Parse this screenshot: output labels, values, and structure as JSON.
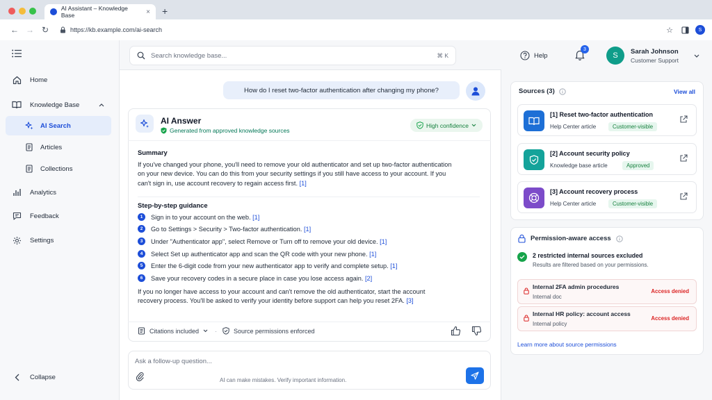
{
  "browser": {
    "tab_title": "AI Assistant – Knowledge Base",
    "url": "https://kb.example.com/ai-search",
    "profile_initial": "S"
  },
  "sidebar": {
    "items": [
      {
        "label": "Home",
        "icon": "home-icon"
      },
      {
        "label": "Knowledge Base",
        "icon": "book-icon"
      },
      {
        "label": "AI Search",
        "icon": "sparkle-icon"
      },
      {
        "label": "Articles",
        "icon": "document-icon"
      },
      {
        "label": "Collections",
        "icon": "document-icon"
      },
      {
        "label": "Analytics",
        "icon": "bar-chart-icon"
      },
      {
        "label": "Feedback",
        "icon": "message-icon"
      },
      {
        "label": "Settings",
        "icon": "gear-icon"
      }
    ],
    "collapse_label": "Collapse"
  },
  "header": {
    "search_placeholder": "Search knowledge base...",
    "search_shortcut": "⌘ K",
    "help_label": "Help",
    "notification_count": "3",
    "user_initial": "S",
    "user_name": "Sarah Johnson",
    "user_role": "Customer Support"
  },
  "chat": {
    "question": "How do I reset two-factor authentication after changing my phone?",
    "answer_title": "AI Answer",
    "answer_subtitle": "Generated from approved knowledge sources",
    "confidence": "High confidence",
    "summary_heading": "Summary",
    "summary_text": "If you've changed your phone, you'll need to remove your old authenticator and set up two-factor authentication on your new device. You can do this from your security settings if you still have access to your account. If you can't sign in, use account recovery to regain access first.",
    "summary_cite": "[1]",
    "steps_heading": "Step-by-step guidance",
    "steps": [
      {
        "num": "1",
        "text": "Sign in to your account on the web.",
        "cite": "[1]"
      },
      {
        "num": "2",
        "text": "Go to Settings > Security > Two-factor authentication.",
        "cite": "[1]"
      },
      {
        "num": "3",
        "text": "Under \"Authenticator app\", select Remove or Turn off to remove your old device.",
        "cite": "[1]"
      },
      {
        "num": "4",
        "text": "Select Set up authenticator app and scan the QR code with your new phone.",
        "cite": "[1]"
      },
      {
        "num": "5",
        "text": "Enter the 6-digit code from your new authenticator app to verify and complete setup.",
        "cite": "[1]"
      },
      {
        "num": "6",
        "text": "Save your recovery codes in a secure place in case you lose access again.",
        "cite": "[2]"
      }
    ],
    "closing_text": "If you no longer have access to your account and can't remove the old authenticator, start the account recovery process. You'll be asked to verify your identity before support can help you reset 2FA.",
    "closing_cite": "[3]",
    "citations_label": "Citations included",
    "permissions_label": "Source permissions enforced",
    "followup_placeholder": "Ask a follow-up question...",
    "disclaimer": "AI can make mistakes. Verify important information."
  },
  "sources": {
    "heading": "Sources (3)",
    "view_all": "View all",
    "items": [
      {
        "title": "[1] Reset two-factor authentication",
        "type": "Help Center article",
        "badge": "Customer-visible",
        "color": "#1d6fd6"
      },
      {
        "title": "[2] Account security policy",
        "type": "Knowledge base article",
        "badge": "Approved",
        "color": "#14a39a"
      },
      {
        "title": "[3] Account recovery process",
        "type": "Help Center article",
        "badge": "Customer-visible",
        "color": "#7c4bc9"
      }
    ]
  },
  "permissions": {
    "heading": "Permission-aware access",
    "excluded_title": "2 restricted internal sources excluded",
    "excluded_sub": "Results are filtered based on your permissions.",
    "denied": [
      {
        "title": "Internal 2FA admin procedures",
        "sub": "Internal doc",
        "status": "Access denied"
      },
      {
        "title": "Internal HR policy: account access",
        "sub": "Internal policy",
        "status": "Access denied"
      }
    ],
    "learn_more": "Learn more about source permissions"
  }
}
